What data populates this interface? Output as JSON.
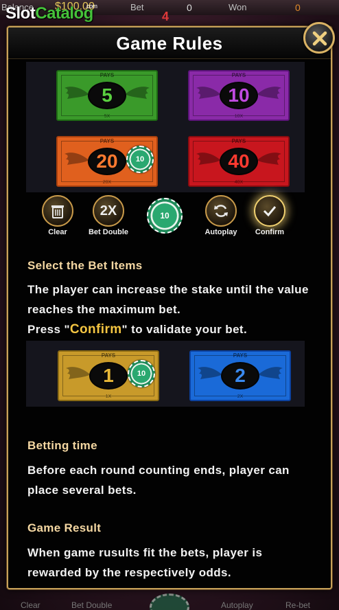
{
  "topbar": {
    "balance_label": "Balance",
    "balance_value": "$100.00",
    "bet_label": "Bet",
    "bet_value": "0",
    "won_label": "Won",
    "won_value": "0",
    "alert_value": "4"
  },
  "watermark": {
    "part1": "Slot",
    "part2": "Catalog",
    "suffix": ".com"
  },
  "modal": {
    "title": "Game Rules",
    "close_icon": "close-x-icon"
  },
  "top_bills": [
    {
      "pays": "PAYS",
      "number": "5",
      "odds": "5X",
      "color": "green"
    },
    {
      "pays": "PAYS",
      "number": "10",
      "odds": "10X",
      "color": "purple"
    },
    {
      "pays": "PAYS",
      "number": "20",
      "odds": "20X",
      "color": "orange"
    },
    {
      "pays": "PAYS",
      "number": "40",
      "odds": "40X",
      "color": "red"
    }
  ],
  "chip_on_bill": "10",
  "controls": {
    "clear_label": "Clear",
    "bet_double_label": "Bet Double",
    "bet_double_icon_text": "2X",
    "chip_value": "10",
    "autoplay_label": "Autoplay",
    "confirm_label": "Confirm"
  },
  "section_select": {
    "title": "Select the Bet Items",
    "text_line1": "The player can increase the stake until the value reaches the maximum bet.",
    "press_prefix": "Press \"",
    "press_highlight": "Confirm",
    "press_suffix": "\" to validate your bet."
  },
  "mid_bills": [
    {
      "pays": "PAYS",
      "number": "1",
      "odds": "1X",
      "color": "gold"
    },
    {
      "pays": "PAYS",
      "number": "2",
      "odds": "2X",
      "color": "blue"
    }
  ],
  "chip_on_mid_bill": "10",
  "section_betting": {
    "title": "Betting time",
    "text": "Before each round counting ends, player can place several bets."
  },
  "section_result": {
    "title": "Game Result",
    "text": "When game rusults fit the bets, player is rewarded by the respectively odds."
  },
  "bottom_bar": {
    "clear": "Clear",
    "bet_double": "Bet Double",
    "autoplay": "Autoplay",
    "rebet": "Re-bet"
  },
  "colors": {
    "modal_border": "#c8a25a",
    "section_title": "#f4d7a2",
    "confirm_highlight": "#f4c542"
  }
}
